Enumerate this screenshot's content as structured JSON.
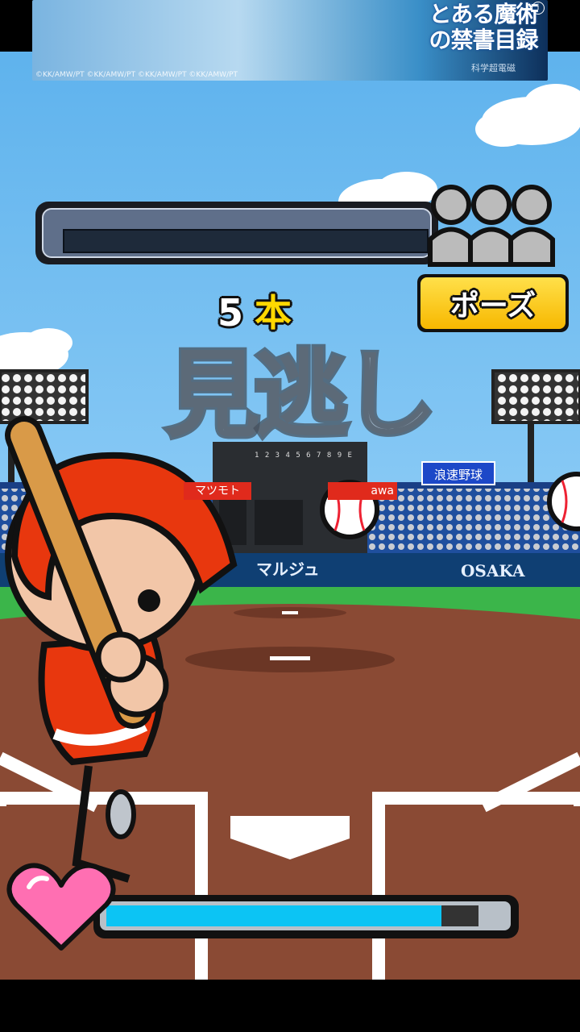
{
  "banner": {
    "title": "とある魔術の禁書目録",
    "subtitle": "科学超電磁",
    "copyright": "©KK/AMW/PT  ©KK/AMW/PT  ©KK/AMW/PT  ©KK/AMW/PT",
    "close_label": "i"
  },
  "hud": {
    "home_run_count": "5",
    "home_run_unit": "本",
    "pause_label": "ポーズ",
    "result_text": "見逃し",
    "crowd_icon": "crowd-silhouette-icon",
    "life_icon": "heart-icon",
    "life_level": 0.9
  },
  "stadium": {
    "sign_left": "マツモト",
    "sign_right": "awa",
    "sign_blue": "浪速野球",
    "scoreboard_digits": "1 2 3 4 5 6 7 8 9  E",
    "wall_left": "マルジュ",
    "wall_right": "OSAKA"
  },
  "colors": {
    "sky": "#6db8ee",
    "grass": "#3bb54a",
    "dirt": "#8a4a34",
    "player": "#e8370e",
    "pause_button": "#f7c400",
    "life_fill": "#0cc4f4",
    "heart": "#ff6fb2"
  }
}
